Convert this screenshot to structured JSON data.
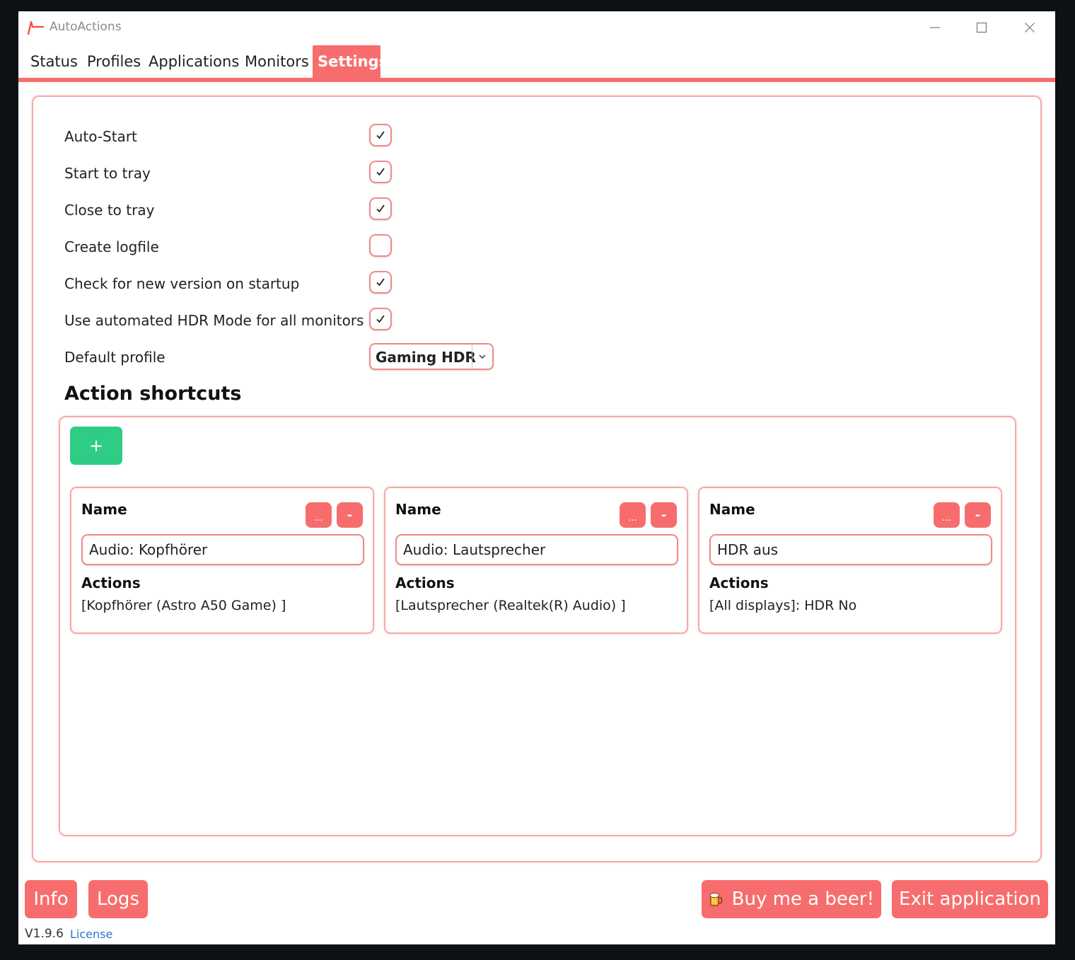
{
  "app": {
    "title": "AutoActions"
  },
  "tabs": [
    {
      "label": "Status"
    },
    {
      "label": "Profiles"
    },
    {
      "label": "Applications"
    },
    {
      "label": "Monitors"
    },
    {
      "label": "Settings",
      "active": true
    }
  ],
  "settings": {
    "auto_start": {
      "label": "Auto-Start",
      "checked": true
    },
    "start_to_tray": {
      "label": "Start to tray",
      "checked": true
    },
    "close_to_tray": {
      "label": "Close to tray",
      "checked": true
    },
    "create_logfile": {
      "label": "Create logfile",
      "checked": false
    },
    "check_version": {
      "label": "Check for new version on startup",
      "checked": true
    },
    "auto_hdr": {
      "label": "Use automated HDR Mode for all monitors",
      "checked": true
    },
    "default_profile": {
      "label": "Default profile",
      "value": "Gaming HDR"
    }
  },
  "shortcuts": {
    "title": "Action shortcuts",
    "add_label": "+",
    "cards": [
      {
        "name_label": "Name",
        "edit_label": "...",
        "remove_label": "-",
        "name_value": "Audio: Kopfhörer",
        "actions_label": "Actions",
        "actions_value": "[Kopfhörer (Astro A50 Game) ]"
      },
      {
        "name_label": "Name",
        "edit_label": "...",
        "remove_label": "-",
        "name_value": "Audio: Lautsprecher",
        "actions_label": "Actions",
        "actions_value": "[Lautsprecher (Realtek(R) Audio) ]"
      },
      {
        "name_label": "Name",
        "edit_label": "...",
        "remove_label": "-",
        "name_value": "HDR aus",
        "actions_label": "Actions",
        "actions_value": "[All displays]: HDR No"
      }
    ]
  },
  "footer": {
    "info_label": "Info",
    "logs_label": "Logs",
    "beer_label": "Buy me a beer!",
    "exit_label": "Exit application",
    "version": "V1.9.6",
    "license_label": "License"
  },
  "colors": {
    "accent": "#f76d6d",
    "add_green": "#2ecc85",
    "link": "#2f72c8"
  },
  "icons": {
    "logo": "autoactions-logo-icon",
    "minimize": "minimize-icon",
    "maximize": "maximize-icon",
    "close": "close-icon",
    "check": "checkmark-icon",
    "dropdown": "chevron-down-icon",
    "beer": "beer-mug-icon"
  }
}
